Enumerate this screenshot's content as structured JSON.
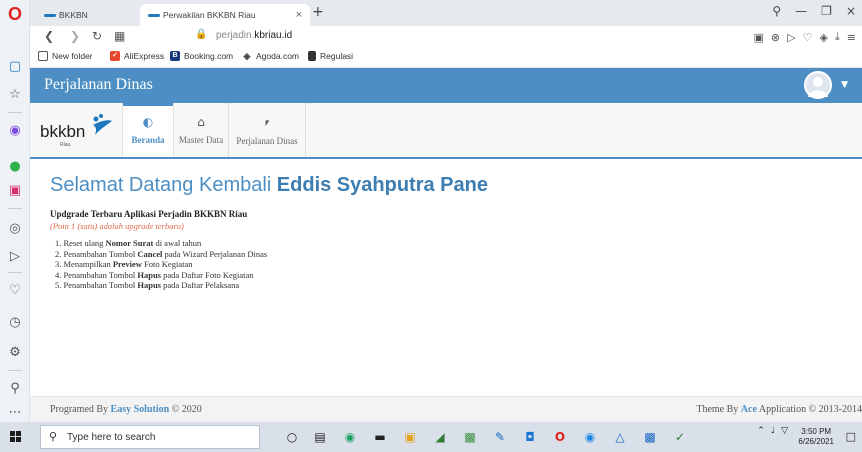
{
  "browser": {
    "tabs": [
      {
        "label": "BKKBN"
      },
      {
        "label": "Perwakilan BKKBN Riau"
      }
    ],
    "new_tab": "+",
    "url_prefix": "perjadin.",
    "url_domain": "kbriau.id",
    "bookmarks": [
      {
        "label": "New folder"
      },
      {
        "label": "AliExpress"
      },
      {
        "label": "Booking.com"
      },
      {
        "label": "Agoda.com"
      },
      {
        "label": "Regulasi"
      }
    ]
  },
  "app": {
    "title": "Perjalanan Dinas",
    "accent": "#4d8fc4"
  },
  "nav": {
    "logo_text": "bkkbn",
    "logo_sub": "Riau",
    "items": [
      {
        "label": "Beranda",
        "icon": "dashboard-icon"
      },
      {
        "label": "Master Data",
        "icon": "home-icon"
      },
      {
        "label": "Perjalanan Dinas",
        "icon": "car-icon"
      }
    ]
  },
  "main": {
    "welcome_prefix": "Selamat Datang Kembali ",
    "welcome_name": "Eddis Syahputra Pane",
    "update_title": "Updgrade Terbaru Aplikasi Perjadin BKKBN Riau",
    "update_note": "(Poin 1 (satu) adalah upgrade terbaru)",
    "updates": [
      {
        "num": "1.",
        "pre": "Reset ulang ",
        "bold": "Nomor Surat",
        "post": " di awal tahun"
      },
      {
        "num": "2.",
        "pre": "Penambahan Tombol ",
        "bold": "Cancel",
        "post": " pada Wizard Perjalanan Dinas"
      },
      {
        "num": "3.",
        "pre": "Menampilkan ",
        "bold": "Preview",
        "post": " Foto Kegiatan"
      },
      {
        "num": "4.",
        "pre": "Penambahan Tombol ",
        "bold": "Hapus",
        "post": " pada Daftar Foto Kegiatan"
      },
      {
        "num": "5.",
        "pre": "Penambahan Tombol ",
        "bold": "Hapus",
        "post": " pada Daftar Pelaksana"
      }
    ]
  },
  "footer": {
    "left_prefix": "Programed By ",
    "left_link": "Easy Solution",
    "left_suffix": " © 2020",
    "right_prefix": "Theme By ",
    "right_link": "Ace",
    "right_suffix": " Application © 2013-2014"
  },
  "taskbar": {
    "search_placeholder": "Type here to search",
    "time": "3:50 PM",
    "date": "6/26/2021"
  }
}
